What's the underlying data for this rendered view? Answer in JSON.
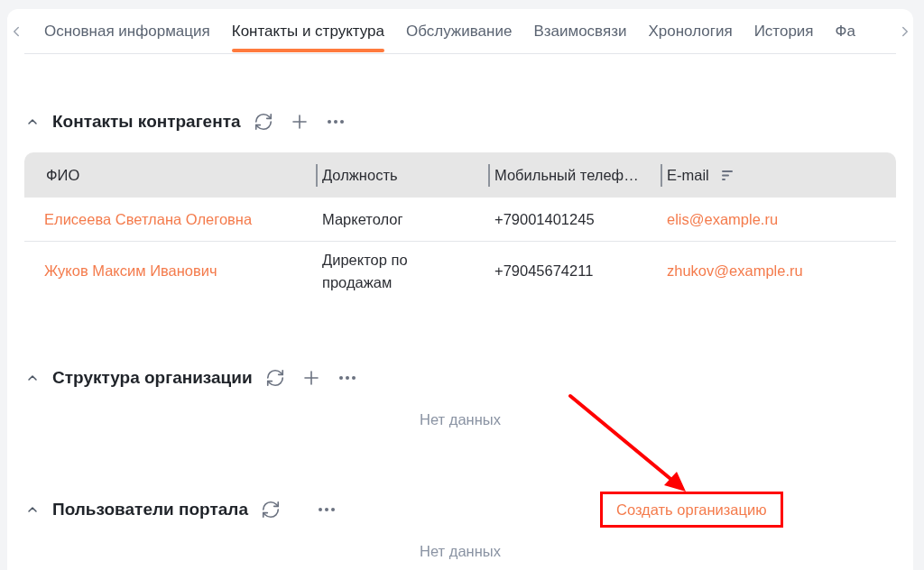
{
  "tabs": [
    {
      "label": "Основная информация",
      "selected": false
    },
    {
      "label": "Контакты и структура",
      "selected": true
    },
    {
      "label": "Обслуживание",
      "selected": false
    },
    {
      "label": "Взаимосвязи",
      "selected": false
    },
    {
      "label": "Хронология",
      "selected": false
    },
    {
      "label": "История",
      "selected": false
    },
    {
      "label": "Фа",
      "selected": false
    }
  ],
  "sections": [
    {
      "title": "Контакты контрагента",
      "expanded": true,
      "actions": [
        {
          "kind": "refresh"
        },
        {
          "kind": "add"
        },
        {
          "kind": "more"
        }
      ],
      "table": {
        "columns": [
          {
            "label": "ФИО",
            "kind": "link",
            "sorted": false
          },
          {
            "label": "Должность",
            "kind": "text",
            "sorted": false
          },
          {
            "label": "Мобильный телеф…",
            "kind": "text",
            "sorted": false
          },
          {
            "label": "E-mail",
            "kind": "link",
            "sorted": true
          }
        ],
        "rows": [
          {
            "cells": [
              "Елисеева Светлана Олеговна",
              "Маркетолог",
              "+79001401245",
              "elis@example.ru"
            ]
          },
          {
            "cells": [
              "Жуков Максим Иванович",
              "Директор по продажам",
              "+79045674211",
              "zhukov@example.ru"
            ]
          }
        ]
      }
    },
    {
      "title": "Структура организации",
      "expanded": true,
      "actions": [
        {
          "kind": "refresh"
        },
        {
          "kind": "add"
        },
        {
          "kind": "more"
        }
      ],
      "empty_text": "Нет данных"
    },
    {
      "title": "Пользователи портала",
      "expanded": true,
      "actions": [
        {
          "kind": "refresh"
        },
        {
          "kind": "spacer"
        },
        {
          "kind": "more"
        }
      ],
      "link": {
        "label": "Создать организацию",
        "highlighted": true
      },
      "empty_text": "Нет данных"
    }
  ]
}
